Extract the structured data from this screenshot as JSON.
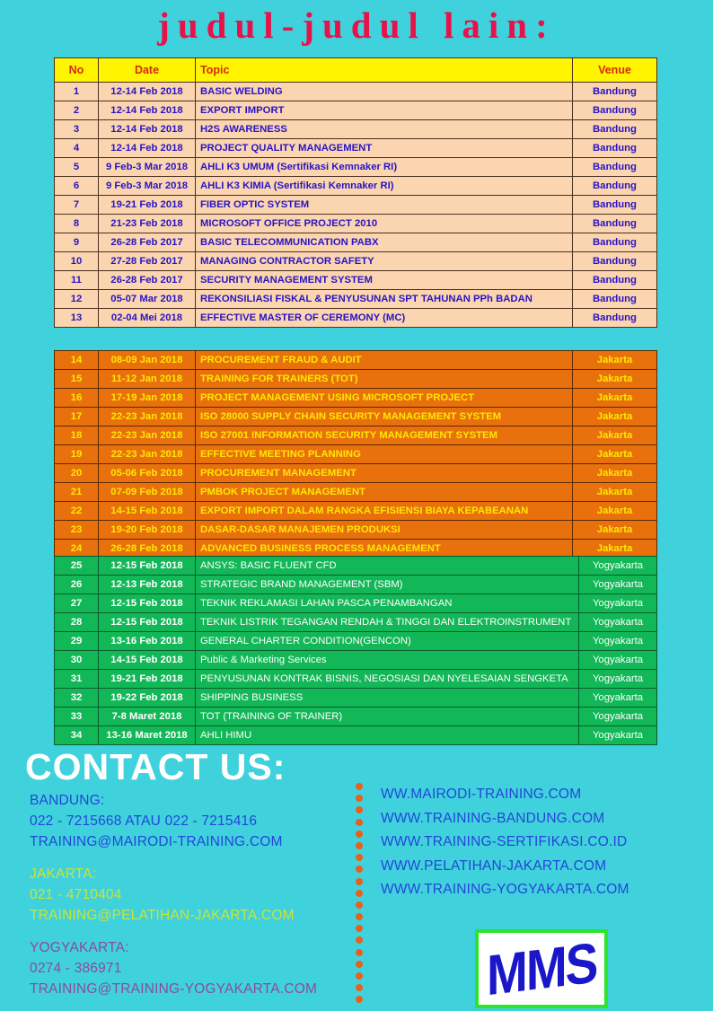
{
  "title": "judul-judul lain:",
  "colors": {
    "background": "#3FD2DD",
    "title": "#E8124A",
    "header_bg": "#FFF500",
    "header_text": "#D52B0E",
    "bandung_bg": "#FAD5B0",
    "bandung_text": "#2914C4",
    "jakarta_bg": "#E8700D",
    "jakarta_text": "#FFE800",
    "yogya_bg": "#12B757",
    "yogya_text": "#FFFFFF",
    "dot": "#E8601C",
    "logo_text": "#1A17C9",
    "logo_border": "#2BE52B"
  },
  "table": {
    "headers": [
      "No",
      "Date",
      "Topic",
      "Venue"
    ],
    "bandung_rows": [
      [
        "1",
        "12-14 Feb 2018",
        "BASIC WELDING",
        "Bandung"
      ],
      [
        "2",
        "12-14 Feb 2018",
        "EXPORT IMPORT",
        "Bandung"
      ],
      [
        "3",
        "12-14 Feb 2018",
        "H2S AWARENESS",
        "Bandung"
      ],
      [
        "4",
        "12-14 Feb 2018",
        "PROJECT QUALITY MANAGEMENT",
        "Bandung"
      ],
      [
        "5",
        "9 Feb-3 Mar 2018",
        "AHLI K3 UMUM (Sertifikasi Kemnaker RI)",
        "Bandung"
      ],
      [
        "6",
        "9 Feb-3 Mar 2018",
        "AHLI K3 KIMIA (Sertifikasi Kemnaker RI)",
        "Bandung"
      ],
      [
        "7",
        "19-21 Feb 2018",
        "FIBER OPTIC SYSTEM",
        "Bandung"
      ],
      [
        "8",
        "21-23 Feb 2018",
        "MICROSOFT OFFICE PROJECT 2010",
        "Bandung"
      ],
      [
        "9",
        "26-28 Feb 2017",
        "BASIC TELECOMMUNICATION PABX",
        "Bandung"
      ],
      [
        "10",
        "27-28 Feb 2017",
        "MANAGING CONTRACTOR SAFETY",
        "Bandung"
      ],
      [
        "11",
        "26-28 Feb 2017",
        "SECURITY MANAGEMENT SYSTEM",
        "Bandung"
      ],
      [
        "12",
        "05-07 Mar 2018",
        "REKONSILIASI FISKAL & PENYUSUNAN SPT TAHUNAN PPh BADAN",
        "Bandung"
      ],
      [
        "13",
        "02-04 Mei 2018",
        "EFFECTIVE MASTER OF CEREMONY (MC)",
        "Bandung"
      ]
    ],
    "jakarta_rows": [
      [
        "14",
        "08-09 Jan 2018",
        "PROCUREMENT FRAUD & AUDIT",
        "Jakarta"
      ],
      [
        "15",
        "11-12 Jan 2018",
        "TRAINING FOR TRAINERS (TOT)",
        "Jakarta"
      ],
      [
        "16",
        "17-19 Jan 2018",
        "PROJECT MANAGEMENT USING MICROSOFT PROJECT",
        "Jakarta"
      ],
      [
        "17",
        "22-23 Jan 2018",
        "ISO 28000 SUPPLY CHAIN SECURITY MANAGEMENT SYSTEM",
        "Jakarta"
      ],
      [
        "18",
        "22-23 Jan 2018",
        "ISO 27001 INFORMATION SECURITY MANAGEMENT SYSTEM",
        "Jakarta"
      ],
      [
        "19",
        "22-23 Jan 2018",
        "EFFECTIVE MEETING PLANNING",
        "Jakarta"
      ],
      [
        "20",
        "05-06 Feb 2018",
        "PROCUREMENT MANAGEMENT",
        "Jakarta"
      ],
      [
        "21",
        "07-09 Feb 2018",
        "PMBOK PROJECT MANAGEMENT",
        "Jakarta"
      ],
      [
        "22",
        "14-15 Feb 2018",
        "EXPORT IMPORT DALAM RANGKA EFISIENSI BIAYA KEPABEANAN",
        "Jakarta"
      ],
      [
        "23",
        "19-20 Feb 2018",
        "DASAR-DASAR MANAJEMEN PRODUKSI",
        "Jakarta"
      ],
      [
        "24",
        "26-28 Feb 2018",
        "ADVANCED BUSINESS PROCESS MANAGEMENT",
        "Jakarta"
      ]
    ],
    "yogya_rows": [
      [
        "25",
        "12-15 Feb 2018",
        "ANSYS: BASIC FLUENT CFD",
        "Yogyakarta"
      ],
      [
        "26",
        "12-13 Feb 2018",
        "STRATEGIC BRAND MANAGEMENT (SBM)",
        "Yogyakarta"
      ],
      [
        "27",
        "12-15 Feb 2018",
        "TEKNIK REKLAMASI LAHAN PASCA PENAMBANGAN",
        "Yogyakarta"
      ],
      [
        "28",
        "12-15 Feb 2018",
        "TEKNIK LISTRIK TEGANGAN RENDAH & TINGGI DAN ELEKTROINSTRUMENT",
        "Yogyakarta"
      ],
      [
        "29",
        "13-16 Feb 2018",
        "GENERAL CHARTER CONDITION(GENCON)",
        "Yogyakarta"
      ],
      [
        "30",
        "14-15 Feb 2018",
        "Public & Marketing Services",
        "Yogyakarta"
      ],
      [
        "31",
        "19-21 Feb 2018",
        "PENYUSUNAN KONTRAK BISNIS, NEGOSIASI DAN NYELESAIAN SENGKETA",
        "Yogyakarta"
      ],
      [
        "32",
        "19-22 Feb 2018",
        "SHIPPING BUSINESS",
        "Yogyakarta"
      ],
      [
        "33",
        "7-8 Maret 2018",
        "TOT (TRAINING OF TRAINER)",
        "Yogyakarta"
      ],
      [
        "34",
        "13-16 Maret 2018",
        "AHLI HIMU",
        "Yogyakarta"
      ]
    ]
  },
  "contact": {
    "heading": "CONTACT US:",
    "groups": [
      {
        "city": "BANDUNG:",
        "phone": "022 - 7215668  ATAU   022 - 7215416",
        "email": "TRAINING@MAIRODI-TRAINING.COM"
      },
      {
        "city": "JAKARTA:",
        "phone": "021 - 4710404",
        "email": "TRAINING@PELATIHAN-JAKARTA.COM"
      },
      {
        "city": "YOGYAKARTA:",
        "phone": "0274 - 386971",
        "email": "TRAINING@TRAINING-YOGYAKARTA.COM"
      }
    ]
  },
  "websites": [
    "WW.MAIRODI-TRAINING.COM",
    "WWW.TRAINING-BANDUNG.COM",
    "WWW.TRAINING-SERTIFIKASI.CO.ID",
    "WWW.PELATIHAN-JAKARTA.COM",
    "WWW.TRAINING-YOGYAKARTA.COM"
  ],
  "logo": {
    "text": "MMS"
  },
  "divider": {
    "dot_count": 19
  }
}
